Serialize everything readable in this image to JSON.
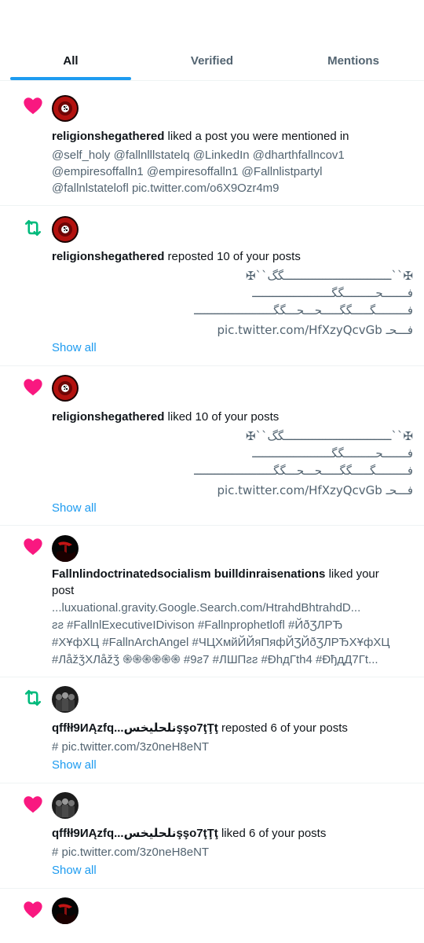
{
  "tabs": [
    {
      "label": "All"
    },
    {
      "label": "Verified"
    },
    {
      "label": "Mentions"
    }
  ],
  "colors": {
    "like": "#f91880",
    "repost": "#00ba7c",
    "link": "#1d9bf0",
    "muted": "#536471"
  },
  "items": [
    {
      "type": "like",
      "icon": "heart-icon",
      "user": "religionshegathered",
      "action": " liked a post you were mentioned in",
      "lines": [
        "@self_holy @fallnlllstatelq @LinkedIn @dharthfallncov1",
        "@empiresoffalln1 @empiresoffalln1 @Fallnlistpartyl",
        "@fallnlstatelofl pic.twitter.com/o6X9Ozr4m9"
      ]
    },
    {
      "type": "repost",
      "icon": "repost-icon",
      "user": "religionshegathered",
      "action": " reposted 10 of your posts",
      "lines": [
        "✠``ـــــــــــــــــــــــــــــــگگ``✠",
        "فـــــــحـــــــــگگـــــــــــــــــــــــ",
        "فـــــــــگـــــگگـــــحـــحـــگگـــــــــــــــــــــــ",
        "pic.twitter.com/HfXzyQcvGb فـــحـ"
      ],
      "show_all": "Show all"
    },
    {
      "type": "like",
      "icon": "heart-icon",
      "user": "religionshegathered",
      "action": " liked 10 of your posts",
      "lines": [
        "✠``ـــــــــــــــــــــــــــــــگگ``✠",
        "فـــــــحـــــــــگگـــــــــــــــــــــــ",
        "فـــــــــگـــــگگـــــحـــحـــگگـــــــــــــــــــــــ",
        "pic.twitter.com/HfXzyQcvGb فـــحـ"
      ],
      "show_all": "Show all"
    },
    {
      "type": "like",
      "icon": "heart-icon",
      "user": "Fallnlindoctrinatedsocialism builldinraisenations",
      "action": " liked your",
      "action2": "post",
      "lines": [
        "...luxuational.gravity.Google.Search.com/HtrahdBhtrahdD...",
        "ƨƨ #FallnlExecutiveIDivison #Fallnprophetlofl #ЙðƷЛΡЂ",
        "#ХҰфХЦ #FallnArchAngel #ЧЦХмйЙЙяПяфЙƷЙðƷЛΡЂХҰфХЦ",
        "#ЛåžǯХЛåžǯ ֍֍֍֍֍֍ #9ƨ7 #ЛШΠƨƨ #ÐhдГth4 #ÐђдД7Гt..."
      ]
    },
    {
      "type": "repost",
      "icon": "repost-icon",
      "user": "qffłł9ИĄzfq...ﻧﻠﺤﻠﻴﺨﺲşşo7ţŢţ",
      "action": " reposted 6 of your posts",
      "lines": [
        "# pic.twitter.com/3z0neH8eNT"
      ],
      "show_all": "Show all"
    },
    {
      "type": "like",
      "icon": "heart-icon",
      "user": "qffłł9ИĄzfq...ﻧﻠﺤﻠﻴﺨﺲşşo7ţŢţ",
      "action": " liked 6 of your posts",
      "lines": [
        "# pic.twitter.com/3z0neH8eNT"
      ],
      "show_all": "Show all"
    },
    {
      "type": "like",
      "icon": "heart-icon"
    }
  ]
}
